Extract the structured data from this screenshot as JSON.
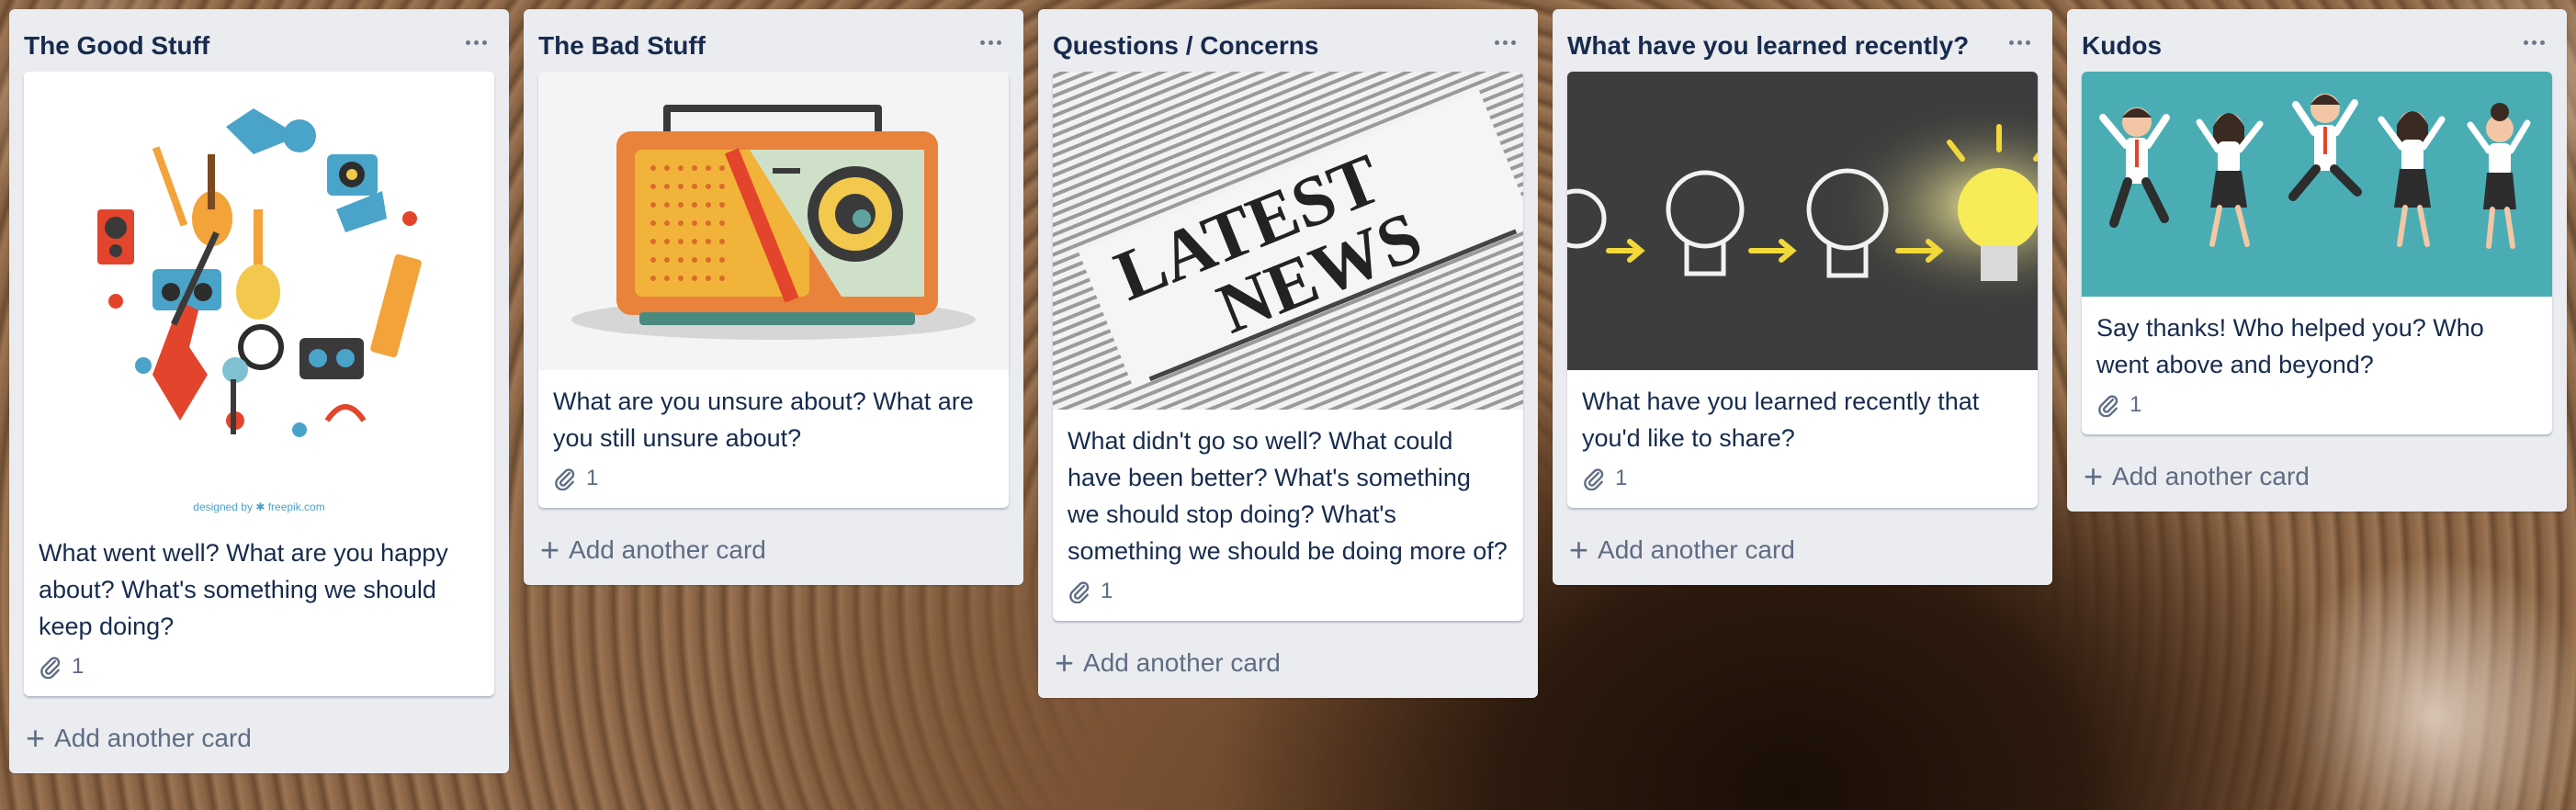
{
  "lists": [
    {
      "title": "The Good Stuff",
      "card_text": "What went well? What are you happy about? What's something we should keep doing?",
      "attachments": "1",
      "add_card": "Add another card",
      "cover_credit": "designed by ✱ freepik.com"
    },
    {
      "title": "The Bad Stuff",
      "card_text": "What are you unsure about? What are you still unsure about?",
      "attachments": "1",
      "add_card": "Add another card"
    },
    {
      "title": "Questions / Concerns",
      "card_text": "What didn't go so well? What could have been better? What's something we should stop doing? What's something we should be doing more of?",
      "attachments": "1",
      "add_card": "Add another card",
      "cover_headline_1": "LATEST",
      "cover_headline_2": "NEWS"
    },
    {
      "title": "What have you learned recently?",
      "card_text": "What have you learned recently that you'd like to share?",
      "attachments": "1",
      "add_card": "Add another card"
    },
    {
      "title": "Kudos",
      "card_text": "Say thanks! Who helped you? Who went above and beyond?",
      "attachments": "1",
      "add_card": "Add another card"
    }
  ],
  "icons": {
    "menu": "ellipsis-icon",
    "attachment": "paperclip-icon",
    "add": "plus-icon"
  },
  "colors": {
    "list_bg": "#ebecf0",
    "title": "#172b4d",
    "muted": "#5e6c84",
    "kudos_cover": "#4aadb4"
  }
}
